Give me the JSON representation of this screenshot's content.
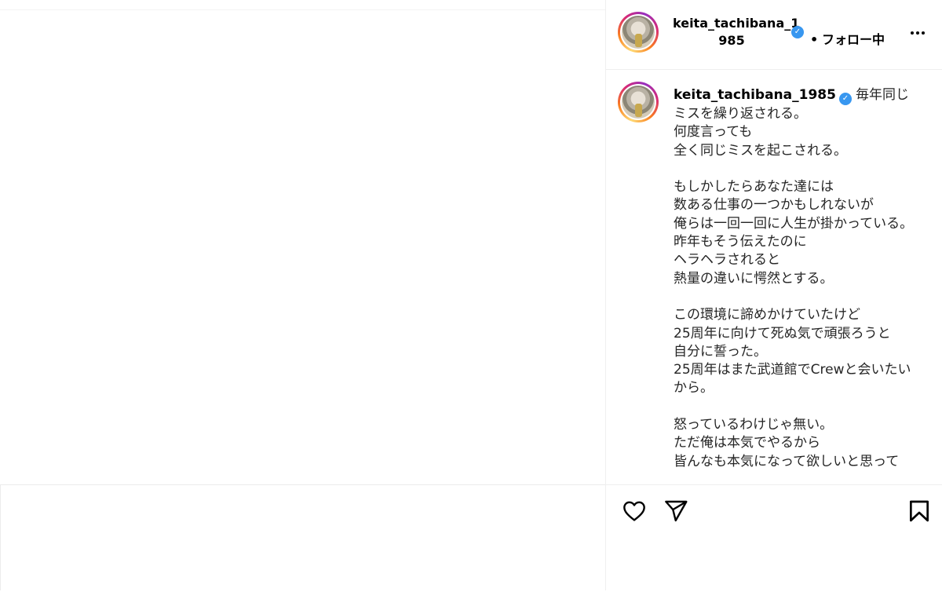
{
  "post": {
    "header": {
      "username_line1": "keita_tachibana_1",
      "username_line2": "985",
      "separator": "•",
      "follow_status": "フォロー中"
    },
    "caption": {
      "author": "keita_tachibana_1985",
      "text": "毎年同じミスを繰り返される。\n何度言っても\n全く同じミスを起こされる。\n\nもしかしたらあなた達には\n数ある仕事の一つかもしれないが\n俺らは一回一回に人生が掛かっている。\n昨年もそう伝えたのに\nヘラヘラされると\n熱量の違いに愕然とする。\n\nこの環境に諦めかけていたけど\n25周年に向けて死ぬ気で頑張ろうと\n自分に誓った。\n25周年はまた武道館でCrewと会いたいから。\n\n怒っているわけじゃ無い。\nただ俺は本気でやるから\n皆んなも本気になって欲しいと思って"
    },
    "icons": {
      "verified": "verified-badge-icon",
      "more": "more-options-icon",
      "like": "heart-icon",
      "share": "paper-plane-icon",
      "save": "bookmark-icon"
    }
  },
  "colors": {
    "verified": "#3897f0",
    "text": "#262626",
    "divider": "#efefef"
  }
}
